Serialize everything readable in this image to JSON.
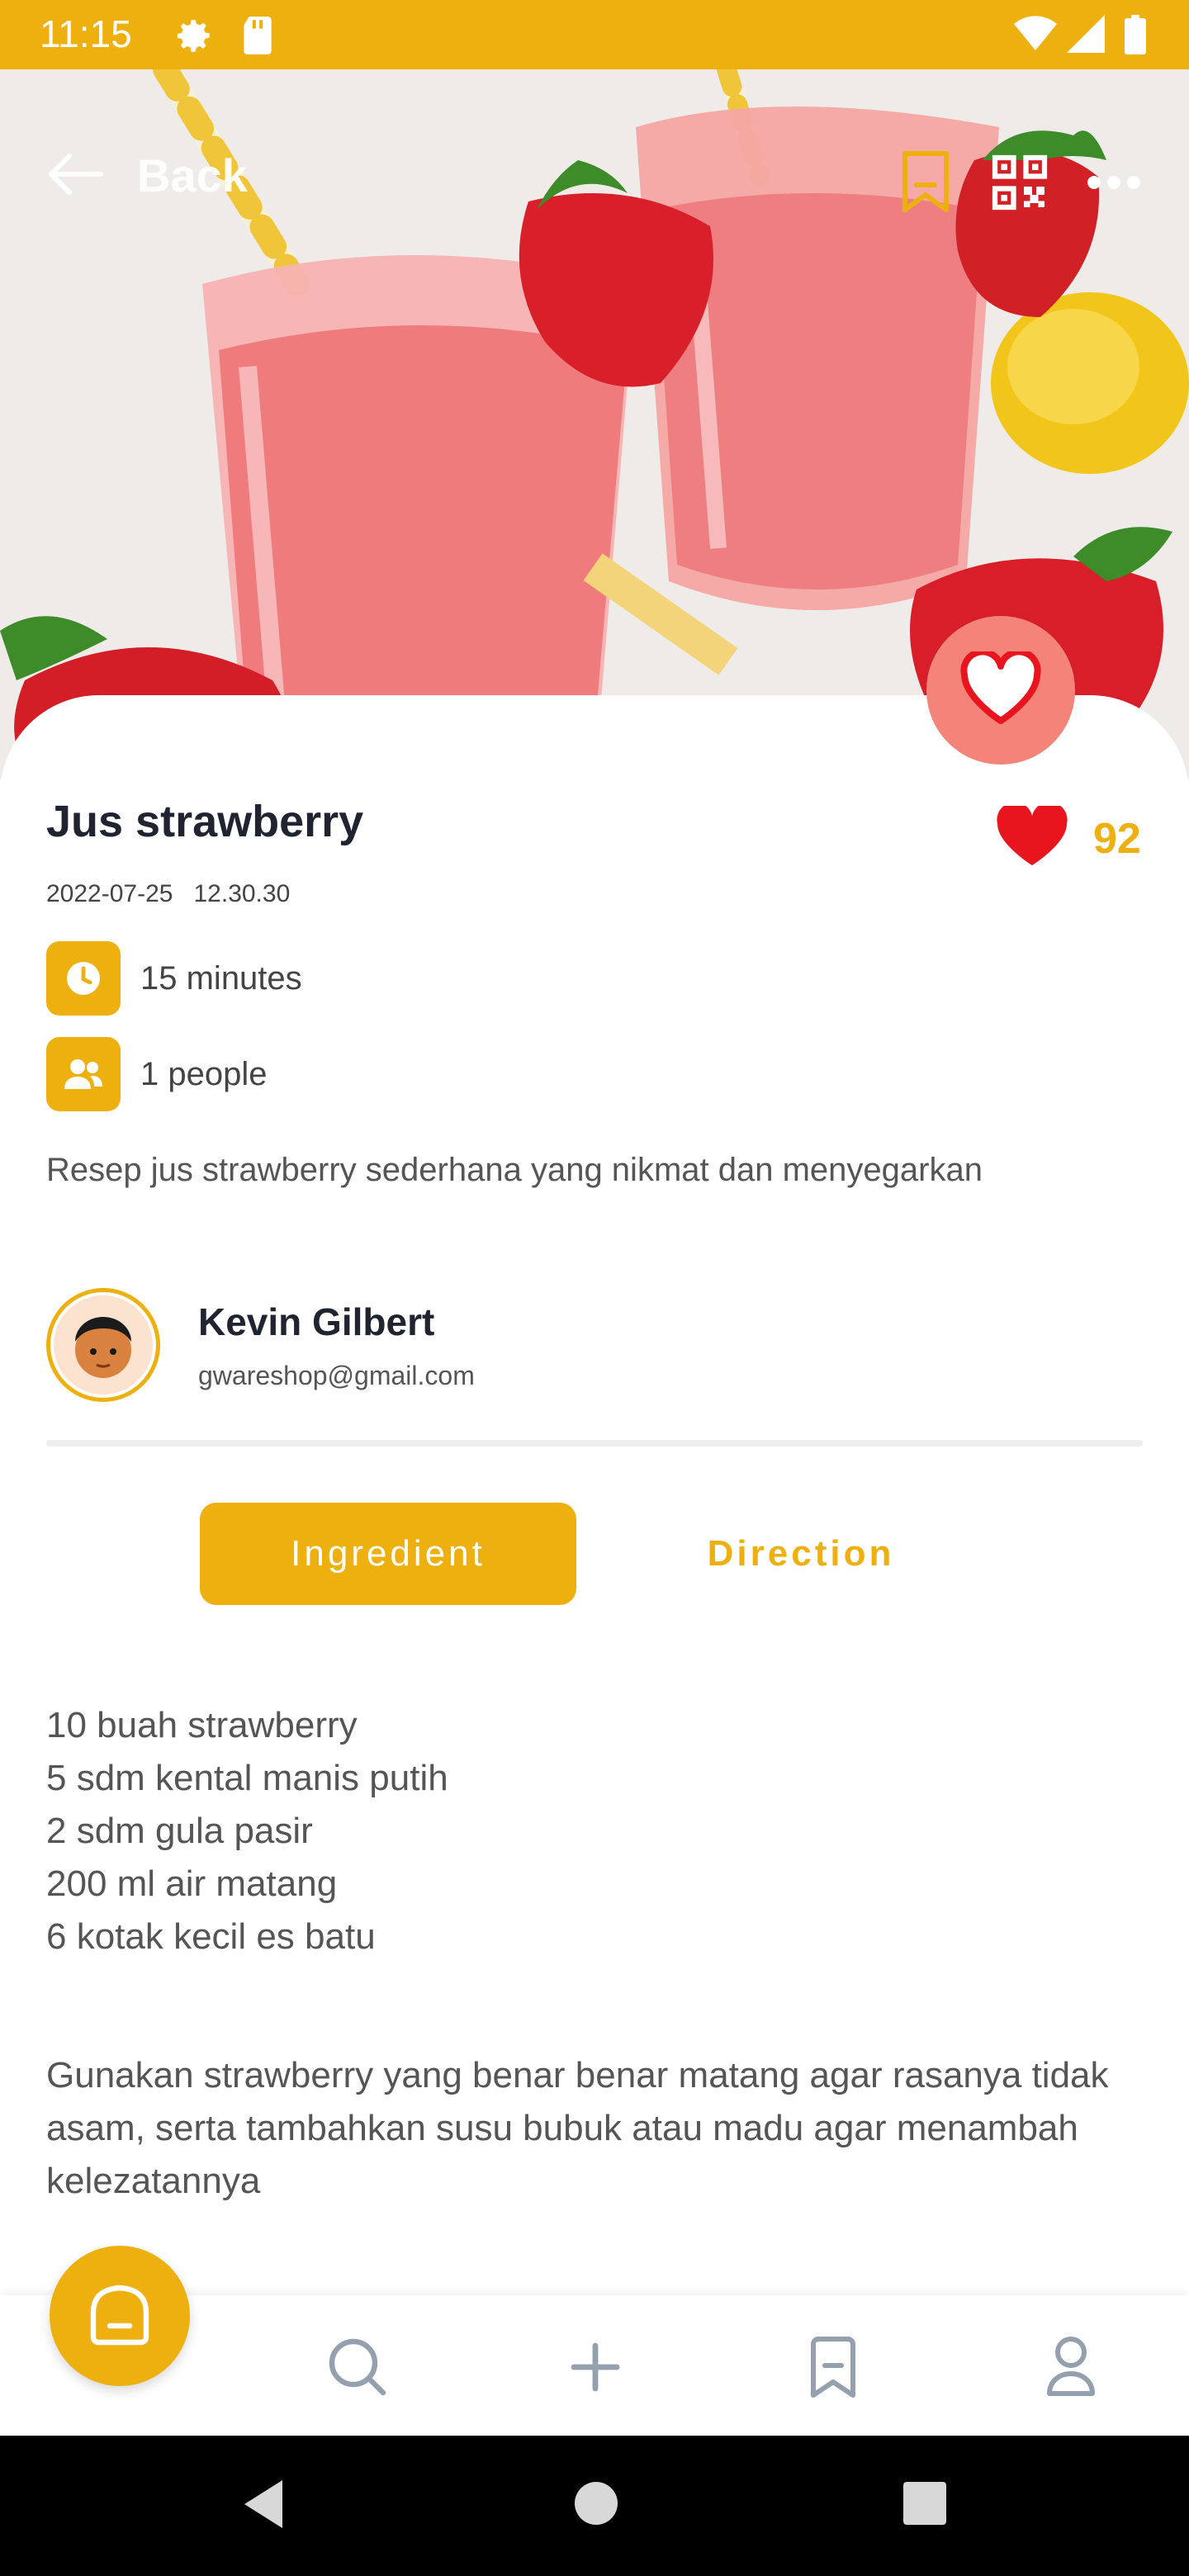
{
  "status_bar": {
    "time": "11:15"
  },
  "top_nav": {
    "back_label": "Back"
  },
  "recipe": {
    "title": "Jus strawberry",
    "date": "2022-07-25",
    "time": "12.30.30",
    "likes": "92",
    "duration": "15 minutes",
    "servings": "1 people",
    "description": "Resep jus strawberry sederhana yang nikmat dan menyegarkan"
  },
  "author": {
    "name": "Kevin Gilbert",
    "email": "gwareshop@gmail.com"
  },
  "tabs": [
    {
      "label": "Ingredient",
      "active": true
    },
    {
      "label": "Direction",
      "active": false
    }
  ],
  "ingredients": [
    "10 buah strawberry",
    "5 sdm kental manis putih",
    "2 sdm gula pasir",
    "200 ml air matang",
    "6 kotak kecil es batu"
  ],
  "tip": "Gunakan strawberry yang benar benar matang agar rasanya tidak asam, serta tambahkan susu bubuk atau madu agar menambah kelezatannya",
  "icons": {
    "back": "arrow-left-icon",
    "bookmark": "bookmark-icon",
    "qr": "qr-code-icon",
    "more": "more-icon",
    "favorite": "heart-outline-icon",
    "like": "heart-filled-icon",
    "clock": "clock-icon",
    "people": "people-icon",
    "home": "home-icon",
    "search": "search-icon",
    "add": "plus-icon",
    "saved": "bookmark-icon",
    "profile": "user-icon"
  },
  "colors": {
    "accent": "#EDB00F",
    "fab": "#F4837A",
    "like": "#E8141E"
  }
}
